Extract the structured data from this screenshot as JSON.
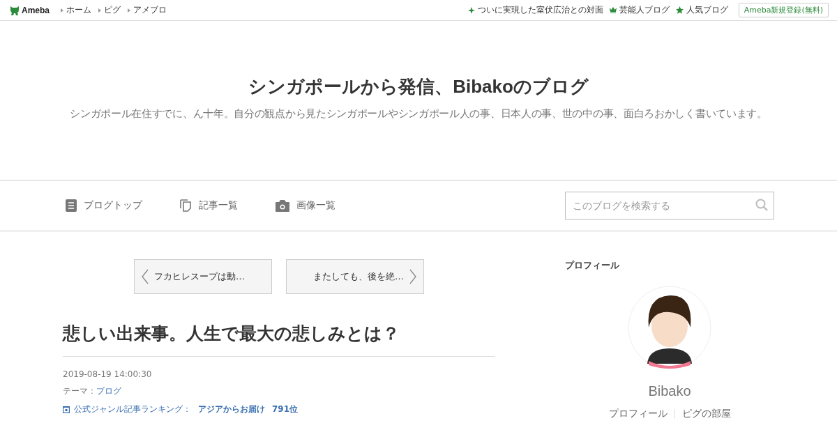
{
  "topbar": {
    "logo": "Ameba",
    "links": [
      "ホーム",
      "ピグ",
      "アメブロ"
    ],
    "promos": [
      {
        "kind": "sparkle",
        "label": "ついに実現した室伏広治との対面"
      },
      {
        "kind": "crown",
        "label": "芸能人ブログ"
      },
      {
        "kind": "star",
        "label": "人気ブログ"
      }
    ],
    "signup": "Ameba新規登録(無料)"
  },
  "blog": {
    "title": "シンガポールから発信、Bibakoのブログ",
    "description": "シンガポール在住すでに、ん十年。自分の観点から見たシンガポールやシンガポール人の事、日本人の事、世の中の事、面白ろおかしく書いています。"
  },
  "nav": {
    "items": [
      {
        "kind": "list",
        "label": "ブログトップ"
      },
      {
        "kind": "copy",
        "label": "記事一覧"
      },
      {
        "kind": "camera",
        "label": "画像一覧"
      }
    ],
    "search": {
      "placeholder": "このブログを検索する"
    }
  },
  "pager": {
    "prev": "フカヒレスープは動…",
    "next": "またしても、後を絶…"
  },
  "article": {
    "title": "悲しい出来事。人生で最大の悲しみとは？",
    "date": "2019-08-19 14:00:30",
    "theme_label": "テーマ：",
    "theme": "ブログ",
    "ranking_label": "公式ジャンル記事ランキング：",
    "ranking_genre": "アジアからお届け",
    "ranking_rank": "791位"
  },
  "profile": {
    "heading": "プロフィール",
    "name": "Bibako",
    "links": [
      "プロフィール",
      "ピグの部屋"
    ]
  }
}
